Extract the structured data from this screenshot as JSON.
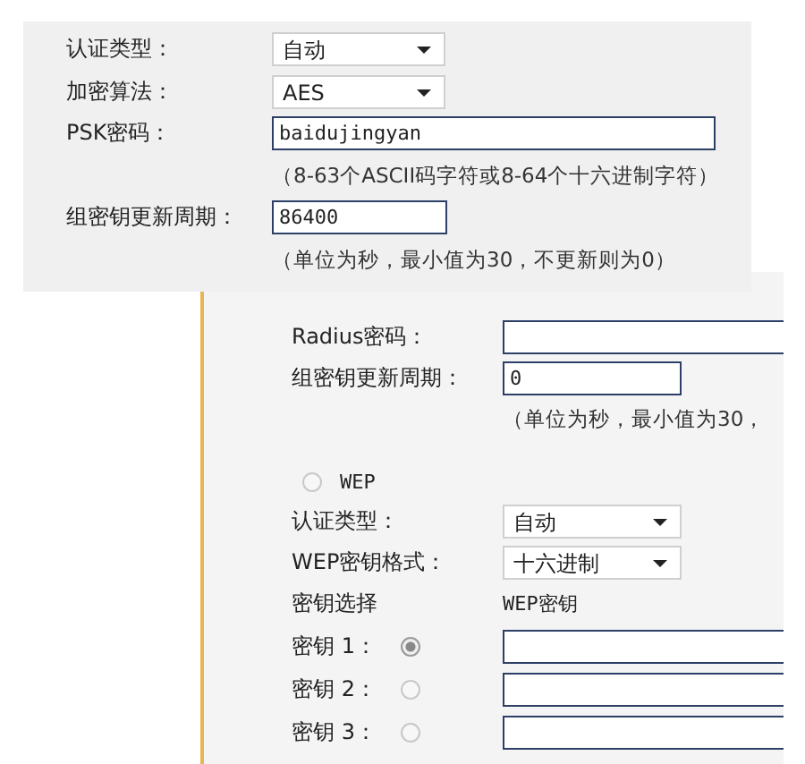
{
  "settings_panel": {
    "fields": [
      {
        "kind": "select",
        "label": "认证类型：",
        "value": "自动"
      },
      {
        "kind": "select",
        "label": "加密算法：",
        "value": "AES"
      },
      {
        "kind": "wide-input",
        "label": "PSK密码：",
        "value": "baidujingyan",
        "hint": "（8-63个ASCII码字符或8-64个十六进制字符）"
      },
      {
        "kind": "input",
        "label": "组密钥更新周期：",
        "value": "86400",
        "hint": "（单位为秒，最小值为30，不更新则为0）"
      }
    ]
  },
  "background_panel": {
    "radius_fields": [
      {
        "kind": "wide-input",
        "label": "Radius密码："
      },
      {
        "kind": "input",
        "label": "组密钥更新周期：",
        "value": "0",
        "hint": "（单位为秒，最小值为30，"
      }
    ],
    "wep": {
      "label": "WEP",
      "selected": false,
      "fields": [
        {
          "kind": "select",
          "label": "认证类型：",
          "value": "自动"
        },
        {
          "kind": "select",
          "label": "WEP密钥格式：",
          "value": "十六进制"
        }
      ],
      "key_select_label": "密钥选择",
      "key_column_label": "WEP密钥",
      "keys": [
        {
          "label": "密钥 1：",
          "selected": true
        },
        {
          "label": "密钥 2：",
          "selected": false
        },
        {
          "label": "密钥 3：",
          "selected": false
        }
      ]
    }
  }
}
